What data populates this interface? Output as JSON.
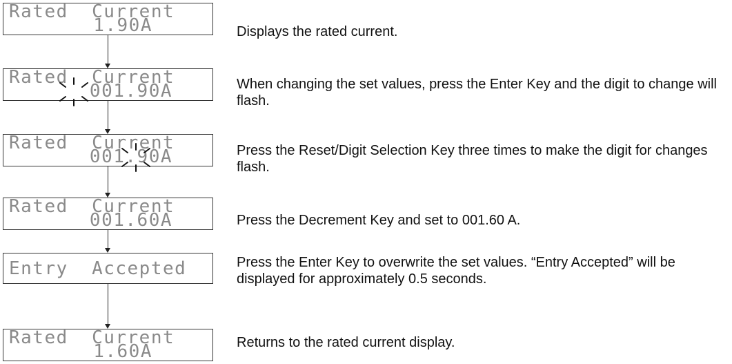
{
  "steps": [
    {
      "display": {
        "line1": "Rated  Current",
        "line2": "1.90A"
      },
      "description": "Displays the rated current."
    },
    {
      "display": {
        "line1": "Rated  Current",
        "line2": "001.90A"
      },
      "description": "When changing the set values, press the Enter Key and the digit to change will flash."
    },
    {
      "display": {
        "line1": "Rated  Current",
        "line2": "001.90A"
      },
      "description": "Press the Reset/Digit Selection Key three times to make the digit for changes flash."
    },
    {
      "display": {
        "line1": "Rated  Current",
        "line2": "001.60A"
      },
      "description": "Press the Decrement Key and set to 001.60 A."
    },
    {
      "display": {
        "line1": "Entry  Accepted"
      },
      "description": "Press the Enter Key to overwrite the set values. “Entry Accepted” will be displayed for approximately 0.5 seconds."
    },
    {
      "display": {
        "line1": "Rated  Current",
        "line2": "1.60A"
      },
      "description": "Returns to the rated current display."
    }
  ]
}
